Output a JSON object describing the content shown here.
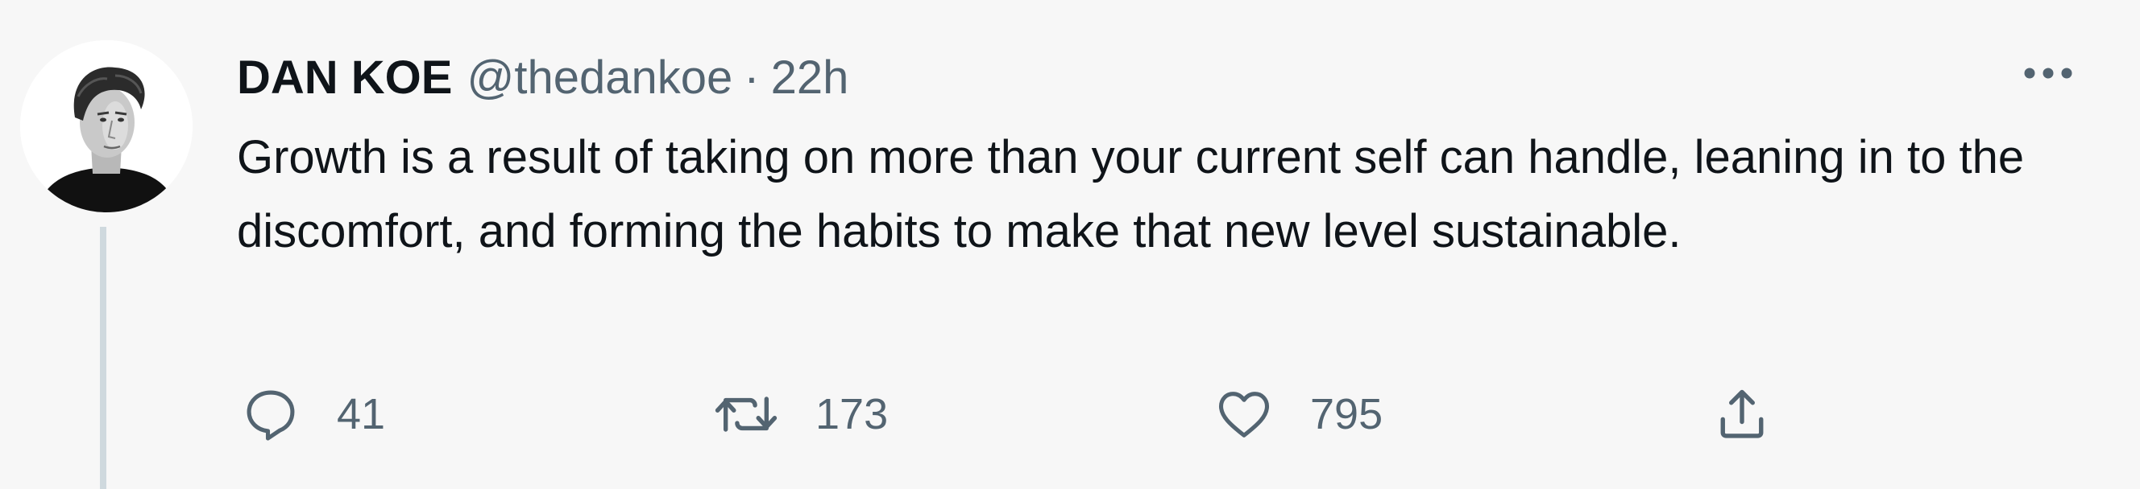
{
  "tweet": {
    "author": {
      "display_name": "DAN KOE",
      "handle": "@thedankoe"
    },
    "separator": "·",
    "timestamp": "22h",
    "text": "Growth is a result of taking on more than your current self can handle, leaning in to the discomfort, and forming the habits to make that new level sustainable.",
    "actions": {
      "reply": {
        "icon": "reply-icon",
        "count": "41"
      },
      "retweet": {
        "icon": "retweet-icon",
        "count": "173"
      },
      "like": {
        "icon": "heart-icon",
        "count": "795"
      },
      "share": {
        "icon": "share-icon"
      }
    },
    "more_icon": "more-options-icon"
  },
  "colors": {
    "background": "#f7f7f7",
    "primary_text": "#0f1419",
    "secondary_text": "#536471",
    "thread_line": "#cfd9de"
  }
}
